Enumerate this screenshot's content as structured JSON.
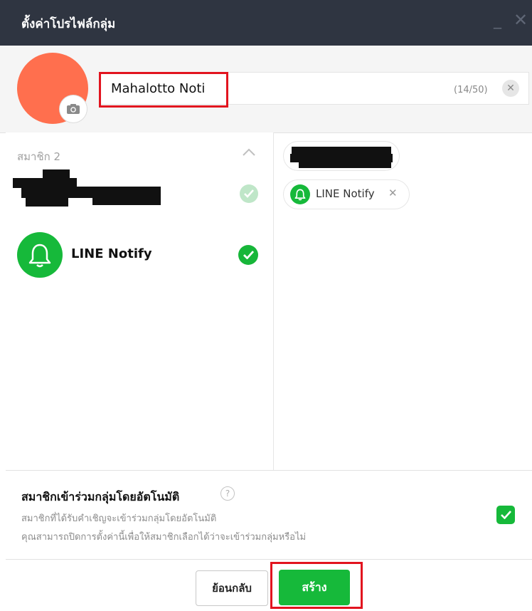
{
  "window": {
    "title": "ตั้งค่าโปรไฟล์กลุ่ม",
    "minimize_glyph": "_",
    "close_glyph": "✕"
  },
  "profile": {
    "avatar_color": "#ff6f4e",
    "camera_icon": "camera-icon",
    "group_name": "Mahalotto Noti",
    "char_count": "(14/50)",
    "clear_glyph": "✕"
  },
  "members": {
    "label": "สมาชิก 2",
    "items": [
      {
        "name_redacted": true,
        "selected": true,
        "check_state": "light"
      },
      {
        "name": "LINE Notify",
        "selected": true,
        "icon": "bell-icon"
      }
    ]
  },
  "selected_chips": [
    {
      "name_redacted": true
    },
    {
      "name": "LINE Notify",
      "icon": "bell-icon",
      "remove_glyph": "✕"
    }
  ],
  "auto_join": {
    "title": "สมาชิกเข้าร่วมกลุ่มโดยอัตโนมัติ",
    "help_glyph": "?",
    "desc_line1": "สมาชิกที่ได้รับคำเชิญจะเข้าร่วมกลุ่มโดยอัตโนมัติ",
    "desc_line2": "คุณสามารถปิดการตั้งค่านี้เพื่อให้สมาชิกเลือกได้ว่าจะเข้าร่วมกลุ่มหรือไม่",
    "checked": true
  },
  "footer": {
    "back_label": "ย้อนกลับ",
    "create_label": "สร้าง"
  },
  "colors": {
    "titlebar": "#2f3541",
    "accent_green": "#16b93a",
    "highlight_red": "#e2141f"
  }
}
